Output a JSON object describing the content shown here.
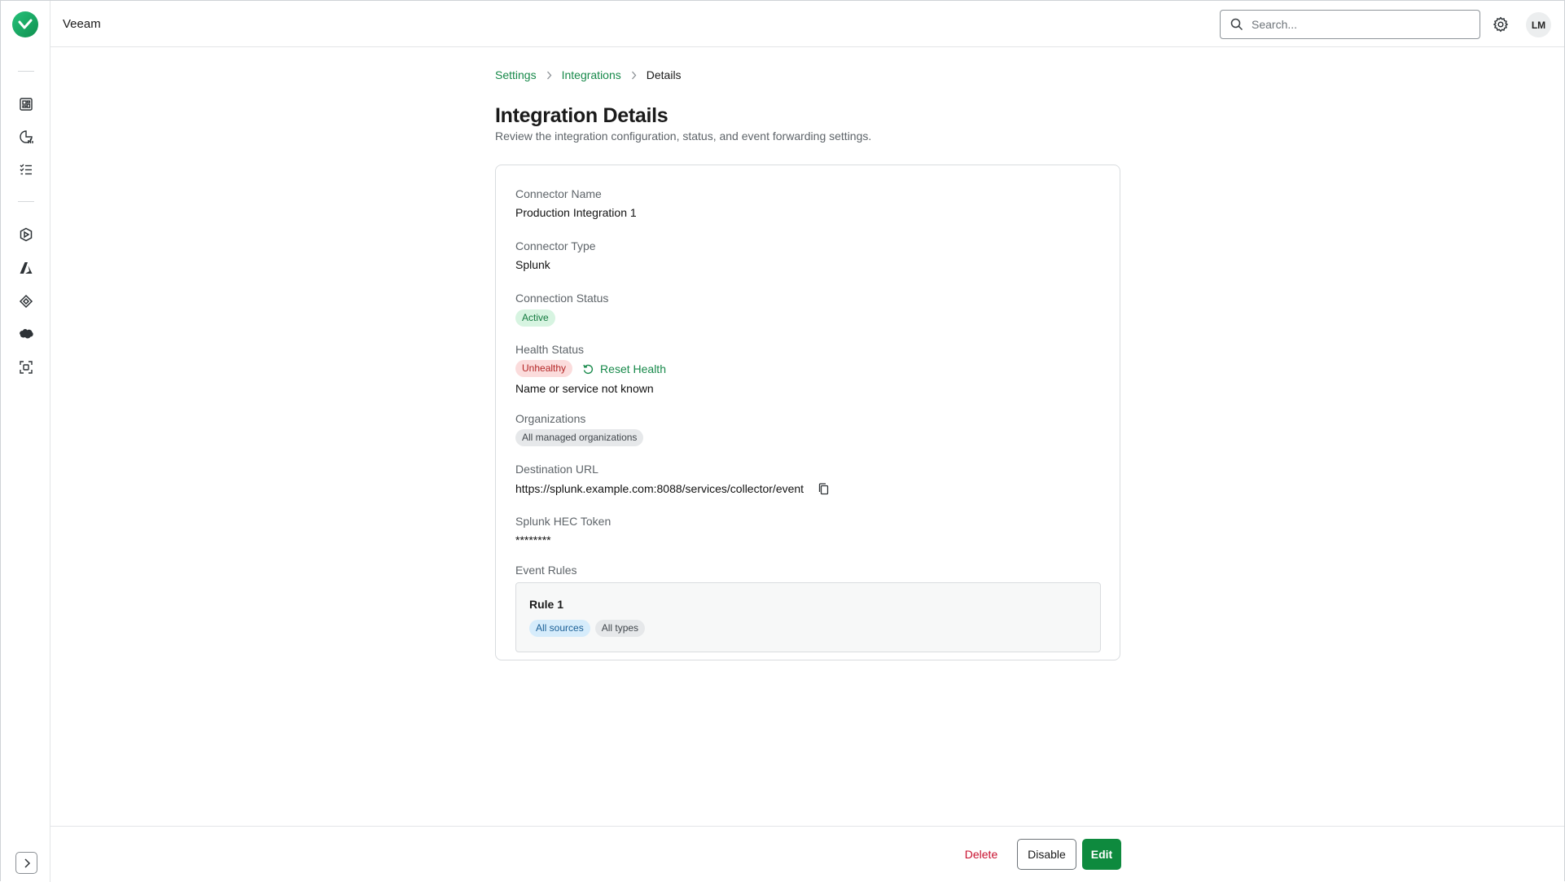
{
  "app": {
    "name": "Veeam"
  },
  "header": {
    "search_placeholder": "Search...",
    "user_initials": "LM"
  },
  "breadcrumb": {
    "items": [
      "Settings",
      "Integrations"
    ],
    "current": "Details"
  },
  "page": {
    "title": "Integration Details",
    "subtitle": "Review the integration configuration, status, and event forwarding settings."
  },
  "details": {
    "connector_name": {
      "label": "Connector Name",
      "value": "Production Integration 1"
    },
    "connector_type": {
      "label": "Connector Type",
      "value": "Splunk"
    },
    "connection_status": {
      "label": "Connection Status",
      "value": "Active"
    },
    "health_status": {
      "label": "Health Status",
      "value": "Unhealthy",
      "action": "Reset Health",
      "message": "Name or service not known"
    },
    "organizations": {
      "label": "Organizations",
      "value": "All managed organizations"
    },
    "destination_url": {
      "label": "Destination URL",
      "value": "https://splunk.example.com:8088/services/collector/event"
    },
    "hec_token": {
      "label": "Splunk HEC Token",
      "value": "********"
    },
    "event_rules": {
      "label": "Event Rules",
      "rules": [
        {
          "title": "Rule 1",
          "tags": [
            "All sources",
            "All types"
          ]
        }
      ]
    }
  },
  "footer": {
    "delete_label": "Delete",
    "disable_label": "Disable",
    "edit_label": "Edit"
  },
  "icons": {
    "sidebar": [
      "dashboard-icon",
      "reports-icon",
      "tasks-icon",
      "m365-icon",
      "azure-icon",
      "gcp-icon",
      "salesforce-icon",
      "scan-icon"
    ],
    "brand_color": "#17894a",
    "primary_button_color": "#0e8a3e",
    "danger_color": "#c8102e"
  }
}
